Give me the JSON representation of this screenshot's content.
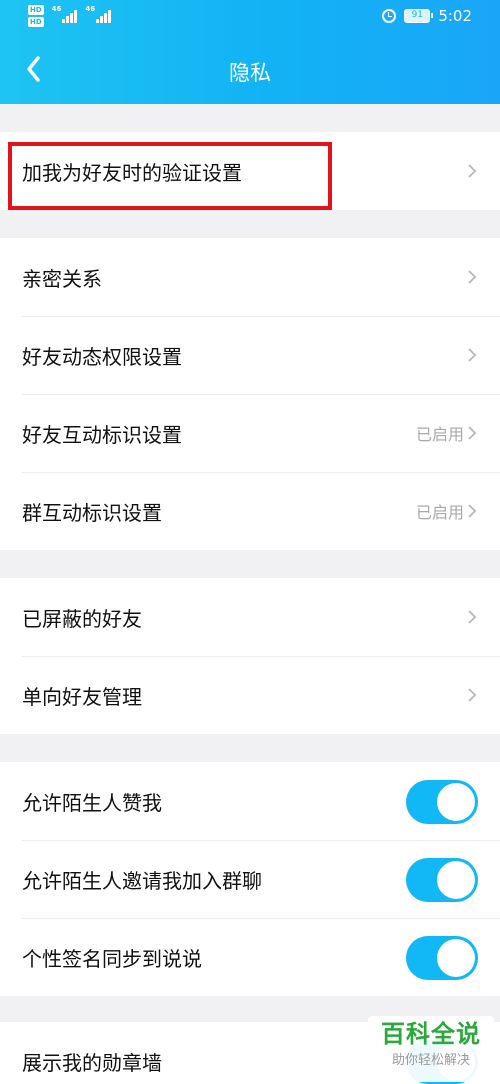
{
  "status_bar": {
    "hd1": "HD",
    "hd2": "HD",
    "signal1": "46",
    "signal2": "46",
    "battery": "91",
    "time": "5:02"
  },
  "header": {
    "title": "隐私"
  },
  "sections": [
    {
      "rows": [
        {
          "label": "加我为好友时的验证设置",
          "status": ""
        }
      ]
    },
    {
      "rows": [
        {
          "label": "亲密关系",
          "status": ""
        },
        {
          "label": "好友动态权限设置",
          "status": ""
        },
        {
          "label": "好友互动标识设置",
          "status": "已启用"
        },
        {
          "label": "群互动标识设置",
          "status": "已启用"
        }
      ]
    },
    {
      "rows": [
        {
          "label": "已屏蔽的好友",
          "status": ""
        },
        {
          "label": "单向好友管理",
          "status": ""
        }
      ]
    },
    {
      "rows": [
        {
          "label": "允许陌生人赞我",
          "enabled": true
        },
        {
          "label": "允许陌生人邀请我加入群聊",
          "enabled": true
        },
        {
          "label": "个性签名同步到说说",
          "enabled": true
        }
      ]
    },
    {
      "rows": [
        {
          "label": "展示我的勋章墙",
          "enabled": true
        }
      ]
    }
  ],
  "watermark": {
    "title": "百科全说",
    "subtitle": "助你轻松解决"
  },
  "colors": {
    "header": "#12b2f5",
    "toggle_on": "#12b7f5",
    "highlight": "#e3131b",
    "watermark": "#2aa83a"
  },
  "icons": [
    "hd-icon",
    "signal-icon",
    "alarm-icon",
    "battery-icon",
    "back-arrow-icon",
    "chevron-right-icon"
  ]
}
